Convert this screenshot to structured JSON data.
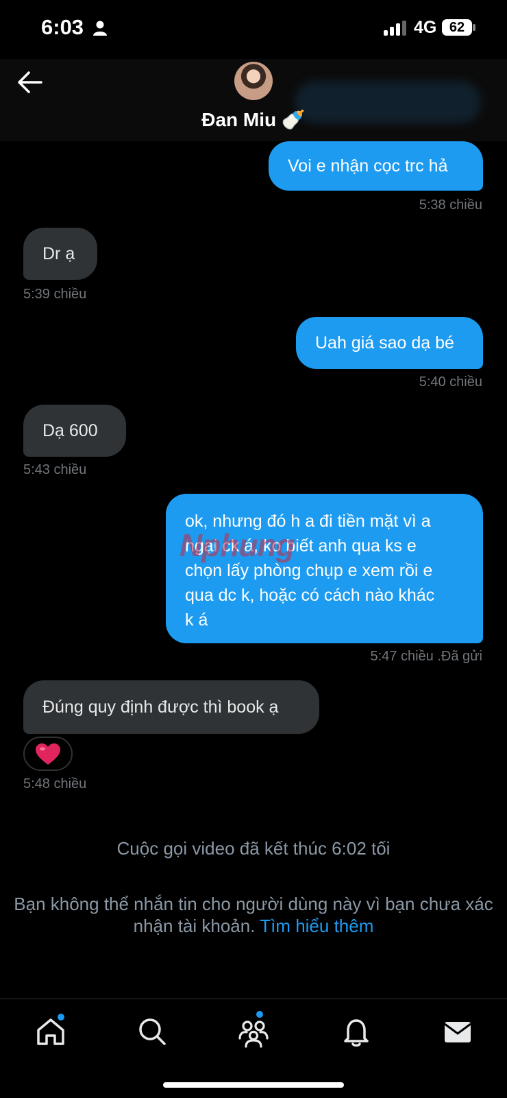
{
  "status_bar": {
    "time": "6:03",
    "network": "4G",
    "battery": "62"
  },
  "header": {
    "name": "Đan Miu",
    "emoji": "🍼"
  },
  "messages": [
    {
      "direction": "out",
      "text": "Voi e nhận cọc trc hả",
      "time": "5:38 chiều"
    },
    {
      "direction": "in",
      "text": "Dr ạ",
      "time": "5:39 chiều"
    },
    {
      "direction": "out",
      "text": "Uah giá sao dạ bé",
      "time": "5:40 chiều"
    },
    {
      "direction": "in",
      "text": "Dạ 600",
      "time": "5:43 chiều"
    },
    {
      "direction": "out",
      "lines": [
        "ok, nhưng đó h a đi tiền mặt vì a",
        "ngại ck á, ko biết anh qua ks e",
        "chọn lấy phòng chụp e xem rồi e",
        "qua dc k, hoặc có cách nào khác",
        "k á"
      ],
      "time": "5:47 chiều",
      "status": ".Đã gửi"
    },
    {
      "direction": "in",
      "text": "Đúng quy định được thì book ạ",
      "reaction": "❤️",
      "time": "5:48 chiều"
    }
  ],
  "watermark": "Nphung",
  "call_event": "Cuộc gọi video đã kết thúc 6:02 tối",
  "notice": {
    "text": "Bạn không thể nhắn tin cho người dùng này vì bạn chưa xác nhận tài khoản.",
    "link": "Tìm hiểu thêm"
  },
  "nav": {
    "items": [
      {
        "icon": "home-icon",
        "badge": true
      },
      {
        "icon": "search-icon",
        "badge": false
      },
      {
        "icon": "communities-icon",
        "badge": true
      },
      {
        "icon": "bell-icon",
        "badge": false
      },
      {
        "icon": "mail-icon",
        "badge": false
      }
    ]
  },
  "colors": {
    "accent": "#1d9bf0",
    "incoming": "#2f3336",
    "muted": "#71767b"
  }
}
